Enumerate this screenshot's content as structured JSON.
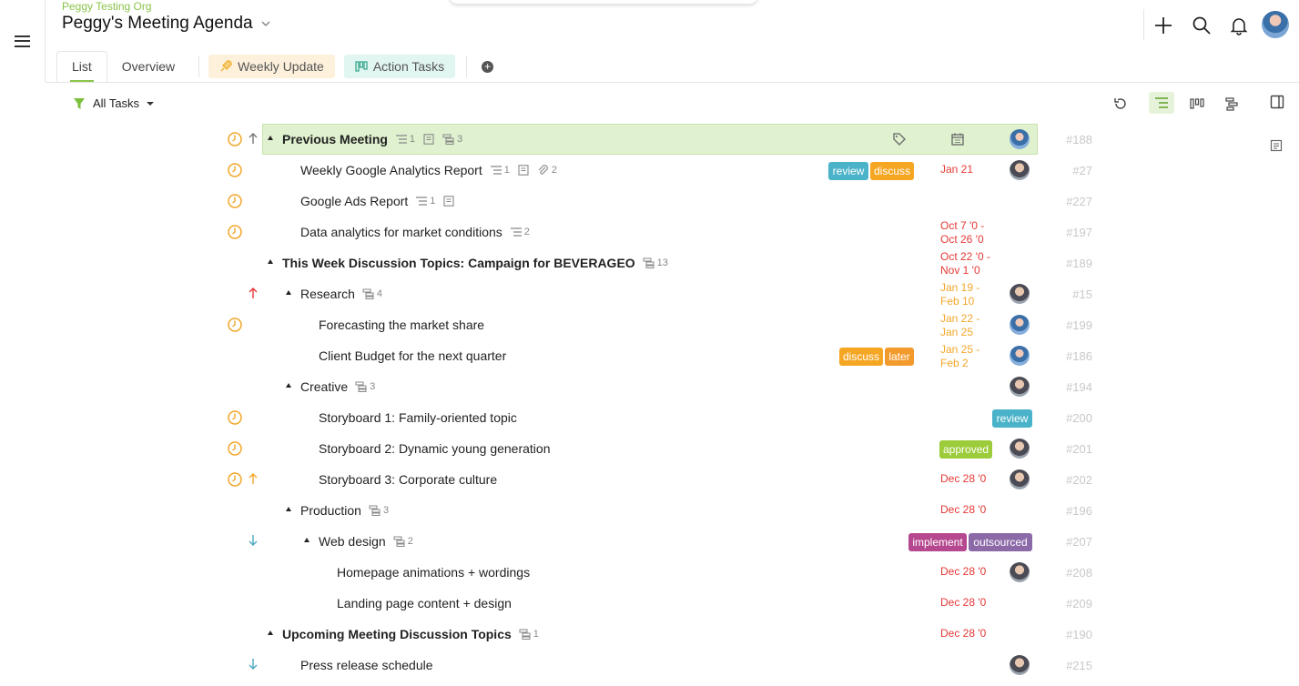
{
  "header": {
    "org": "Peggy Testing Org",
    "title": "Peggy's Meeting Agenda"
  },
  "tabs": [
    {
      "label": "List",
      "active": true
    },
    {
      "label": "Overview"
    }
  ],
  "view_tabs": [
    {
      "label": "Weekly Update",
      "icon": "rocket-icon"
    },
    {
      "label": "Action Tasks",
      "icon": "kanban-icon"
    }
  ],
  "filter": {
    "label": "All Tasks"
  },
  "colors": {
    "accent": "#8bc34a",
    "highlight": "#dff1cf",
    "overdue": "#e53935",
    "upcoming": "#f3a62a",
    "tag_review": "#4bb3c9",
    "tag_discuss": "#f5a623",
    "tag_later": "#f39a2c",
    "tag_approved": "#9ccc3a",
    "tag_implement": "#b5488f",
    "tag_outsourced": "#8c6aa8"
  },
  "rows": [
    {
      "name": "Previous Meeting",
      "bold": true,
      "level": 0,
      "expandable": true,
      "clock": true,
      "arrow": "up-grey",
      "meta": {
        "comments": "1",
        "note": true,
        "subtasks": "3"
      },
      "highlight": true,
      "avatar": "b",
      "num": "#188"
    },
    {
      "name": "Weekly Google Analytics Report",
      "level": 1,
      "clock": true,
      "meta": {
        "comments": "1",
        "note": true,
        "attachments": "2"
      },
      "tags": [
        "review",
        "discuss"
      ],
      "date": "Jan 21",
      "date_color": "red",
      "avatar": "a",
      "num": "#27"
    },
    {
      "name": "Google Ads Report",
      "level": 1,
      "clock": true,
      "meta": {
        "comments": "1",
        "note": true
      },
      "num": "#227"
    },
    {
      "name": "Data analytics for market conditions",
      "level": 1,
      "clock": true,
      "meta": {
        "comments": "2"
      },
      "date": "Oct 7 '0 -",
      "date2": "Oct 26 '0",
      "date_color": "red",
      "num": "#197"
    },
    {
      "name": "This Week Discussion Topics: Campaign for BEVERAGEO",
      "bold": true,
      "level": 0,
      "expandable": true,
      "meta": {
        "subtasks": "13"
      },
      "date": "Oct 22 '0 -",
      "date2": "Nov 1 '0",
      "date_color": "red",
      "num": "#189"
    },
    {
      "name": "Research",
      "level": 1,
      "expandable": true,
      "arrow": "up-red",
      "meta": {
        "subtasks": "4"
      },
      "date": "Jan 19 -",
      "date2": "Feb 10",
      "date_color": "orange",
      "avatar": "a",
      "num": "#15"
    },
    {
      "name": "Forecasting the market share",
      "level": 2,
      "clock": true,
      "date": "Jan 22 -",
      "date2": "Jan 25",
      "date_color": "orange",
      "avatar": "b",
      "num": "#199"
    },
    {
      "name": "Client Budget for the next quarter",
      "level": 2,
      "tags": [
        "discuss",
        "later"
      ],
      "date": "Jan 25 -",
      "date2": "Feb 2",
      "date_color": "orange",
      "avatar": "b",
      "num": "#186"
    },
    {
      "name": "Creative",
      "level": 1,
      "expandable": true,
      "meta": {
        "subtasks": "3"
      },
      "avatar": "a",
      "num": "#194"
    },
    {
      "name": "Storyboard 1: Family-oriented topic",
      "level": 2,
      "clock": true,
      "tags": [
        "review"
      ],
      "num": "#200"
    },
    {
      "name": "Storyboard 2: Dynamic young generation",
      "level": 2,
      "clock": true,
      "tags": [
        "approved"
      ],
      "avatar": "a",
      "num": "#201"
    },
    {
      "name": "Storyboard 3: Corporate culture",
      "level": 2,
      "clock": true,
      "arrow": "up-orange",
      "date": "Dec 28 '0",
      "date_color": "red",
      "avatar": "a",
      "num": "#202"
    },
    {
      "name": "Production",
      "level": 1,
      "expandable": true,
      "meta": {
        "subtasks": "3"
      },
      "date": "Dec 28 '0",
      "date_color": "red",
      "num": "#196"
    },
    {
      "name": "Web design",
      "level": 2,
      "expandable": true,
      "arrow": "down-teal",
      "meta": {
        "subtasks": "2"
      },
      "tags": [
        "implement",
        "outsourced"
      ],
      "num": "#207"
    },
    {
      "name": "Homepage animations + wordings",
      "level": 3,
      "date": "Dec 28 '0",
      "date_color": "red",
      "avatar": "a",
      "num": "#208"
    },
    {
      "name": "Landing page content + design",
      "level": 3,
      "date": "Dec 28 '0",
      "date_color": "red",
      "num": "#209"
    },
    {
      "name": "Upcoming Meeting Discussion Topics",
      "bold": true,
      "level": 0,
      "expandable": true,
      "meta": {
        "subtasks": "1"
      },
      "date": "Dec 28 '0",
      "date_color": "red",
      "num": "#190"
    },
    {
      "name": "Press release schedule",
      "level": 1,
      "arrow": "down-teal",
      "avatar": "a",
      "num": "#215"
    }
  ]
}
